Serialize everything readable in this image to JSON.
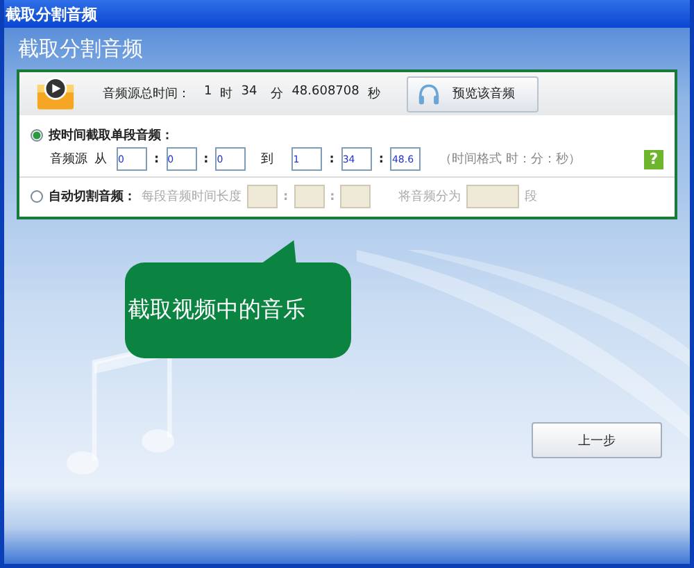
{
  "window": {
    "title": "截取分割音频"
  },
  "heading": "截取分割音频",
  "source": {
    "label": "音频源总时间：",
    "hours": "1",
    "hours_unit": "时",
    "minutes": "34",
    "minutes_unit": "分",
    "seconds": "48.608708",
    "seconds_unit": "秒",
    "preview_button": "预览该音频"
  },
  "modes": [
    {
      "kind": "single",
      "label": "按时间截取单段音频：",
      "selected": true,
      "source_label": "音频源",
      "from_label": "从",
      "from": [
        "0",
        "0",
        "0"
      ],
      "to_label": "到",
      "to": [
        "1",
        "34",
        "48.6"
      ],
      "separator": ":",
      "hint": "（时间格式 时：分：秒）",
      "help": "?"
    },
    {
      "kind": "auto",
      "label": "自动切割音频：",
      "selected": false,
      "segment_label": "每段音频时间长度",
      "separator": ":",
      "split_label": "将音频分为",
      "split_unit": "段"
    }
  ],
  "bubble": "截取视频中的音乐",
  "back_button": "上一步"
}
